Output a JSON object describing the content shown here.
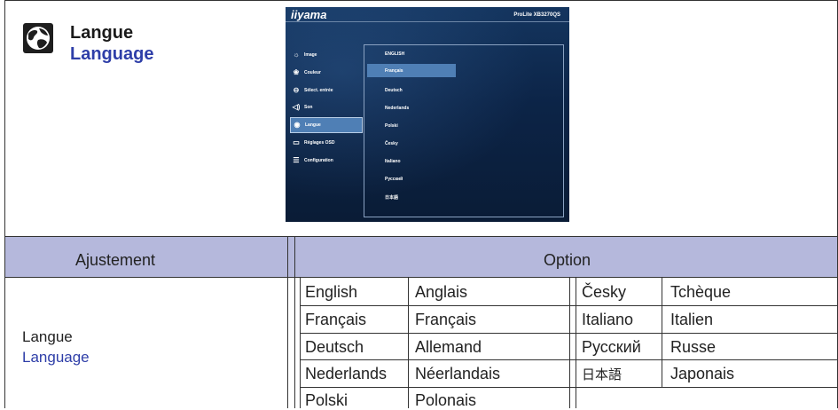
{
  "header": {
    "title_fr": "Langue",
    "title_en": "Language",
    "icon": "globe-icon"
  },
  "osd": {
    "brand": "iiyama",
    "model": "ProLite XB3270QS",
    "menu": [
      {
        "label": "Image",
        "icon": "brightness-icon"
      },
      {
        "label": "Couleur",
        "icon": "color-icon"
      },
      {
        "label": "Sélect. entrée",
        "icon": "input-icon"
      },
      {
        "label": "Son",
        "icon": "speaker-icon"
      },
      {
        "label": "Langue",
        "icon": "globe-icon",
        "selected": true
      },
      {
        "label": "Réglages OSD",
        "icon": "osd-icon"
      },
      {
        "label": "Configuration",
        "icon": "settings-icon"
      }
    ],
    "languages": [
      "ENGLISH",
      "Français",
      "Deutsch",
      "Nederlands",
      "Polski",
      "Česky",
      "Italiano",
      "Русский",
      "日本語"
    ],
    "selected_language": "Français"
  },
  "table": {
    "header_left": "Ajustement",
    "header_right": "Option",
    "adjust_fr": "Langue",
    "adjust_en": "Language",
    "rows_left": [
      [
        "English",
        "Anglais"
      ],
      [
        "Français",
        "Français"
      ],
      [
        "Deutsch",
        "Allemand"
      ],
      [
        "Nederlands",
        "Néerlandais"
      ],
      [
        "Polski",
        "Polonais"
      ]
    ],
    "rows_right": [
      [
        "Česky",
        "Tchèque"
      ],
      [
        "Italiano",
        "Italien"
      ],
      [
        "Русский",
        "Russe"
      ],
      [
        "日本語",
        "Japonais"
      ]
    ]
  },
  "colors": {
    "header_bg": "#b5b8dc",
    "accent_blue": "#2e3ea8"
  }
}
